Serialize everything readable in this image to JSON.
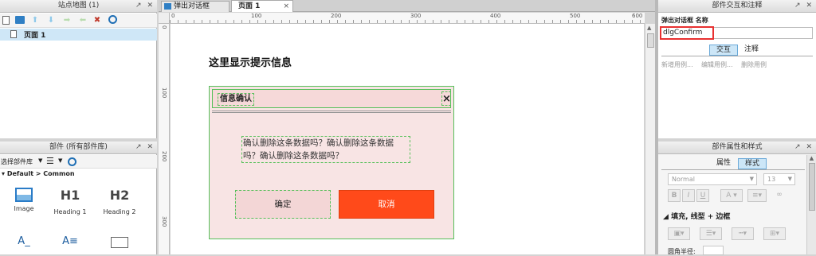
{
  "sitemap": {
    "title": "站点地图 (1)",
    "pages": [
      {
        "label": "页面 1"
      }
    ]
  },
  "components": {
    "title": "部件 (所有部件库)",
    "library_select": "选择部件库",
    "group": "Default > Common",
    "items": [
      {
        "label": "Image",
        "icon": "image-icon"
      },
      {
        "label": "Heading 1",
        "glyph": "H1"
      },
      {
        "label": "Heading 2",
        "glyph": "H2"
      },
      {
        "label": "",
        "glyph": "A_"
      },
      {
        "label": "",
        "glyph": "A≡"
      },
      {
        "label": "",
        "glyph": ""
      }
    ]
  },
  "tabs": [
    {
      "label": "弹出对话框",
      "active": false
    },
    {
      "label": "页面 1",
      "active": true
    }
  ],
  "ruler": {
    "h_ticks": [
      "0",
      "100",
      "200",
      "300",
      "400",
      "500",
      "600"
    ],
    "v_ticks": [
      "0",
      "100",
      "200",
      "300"
    ]
  },
  "canvas": {
    "prompt": "这里显示提示信息",
    "dialog": {
      "title": "信息确认",
      "close": "×",
      "message": "确认删除这条数据吗？确认删除这条数据吗？确认删除这条数据吗？",
      "ok": "确定",
      "cancel": "取消",
      "bg_color": "#f8e4e4",
      "cancel_color": "#ff4a1a"
    }
  },
  "interaction_panel": {
    "title": "部件交互和注释",
    "name_label": "弹出对话框 名称",
    "name_value": "dlgConfirm",
    "tab_interact": "交互",
    "tab_notes": "注释",
    "actions": [
      "新增用例...",
      "编辑用例...",
      "删除用例"
    ]
  },
  "style_panel": {
    "title": "部件属性和样式",
    "tab_props": "属性",
    "tab_style": "样式",
    "font_style": "Normal",
    "font_size": "13",
    "section": "填充, 线型 + 边框",
    "corner_label": "圆角半径:"
  }
}
